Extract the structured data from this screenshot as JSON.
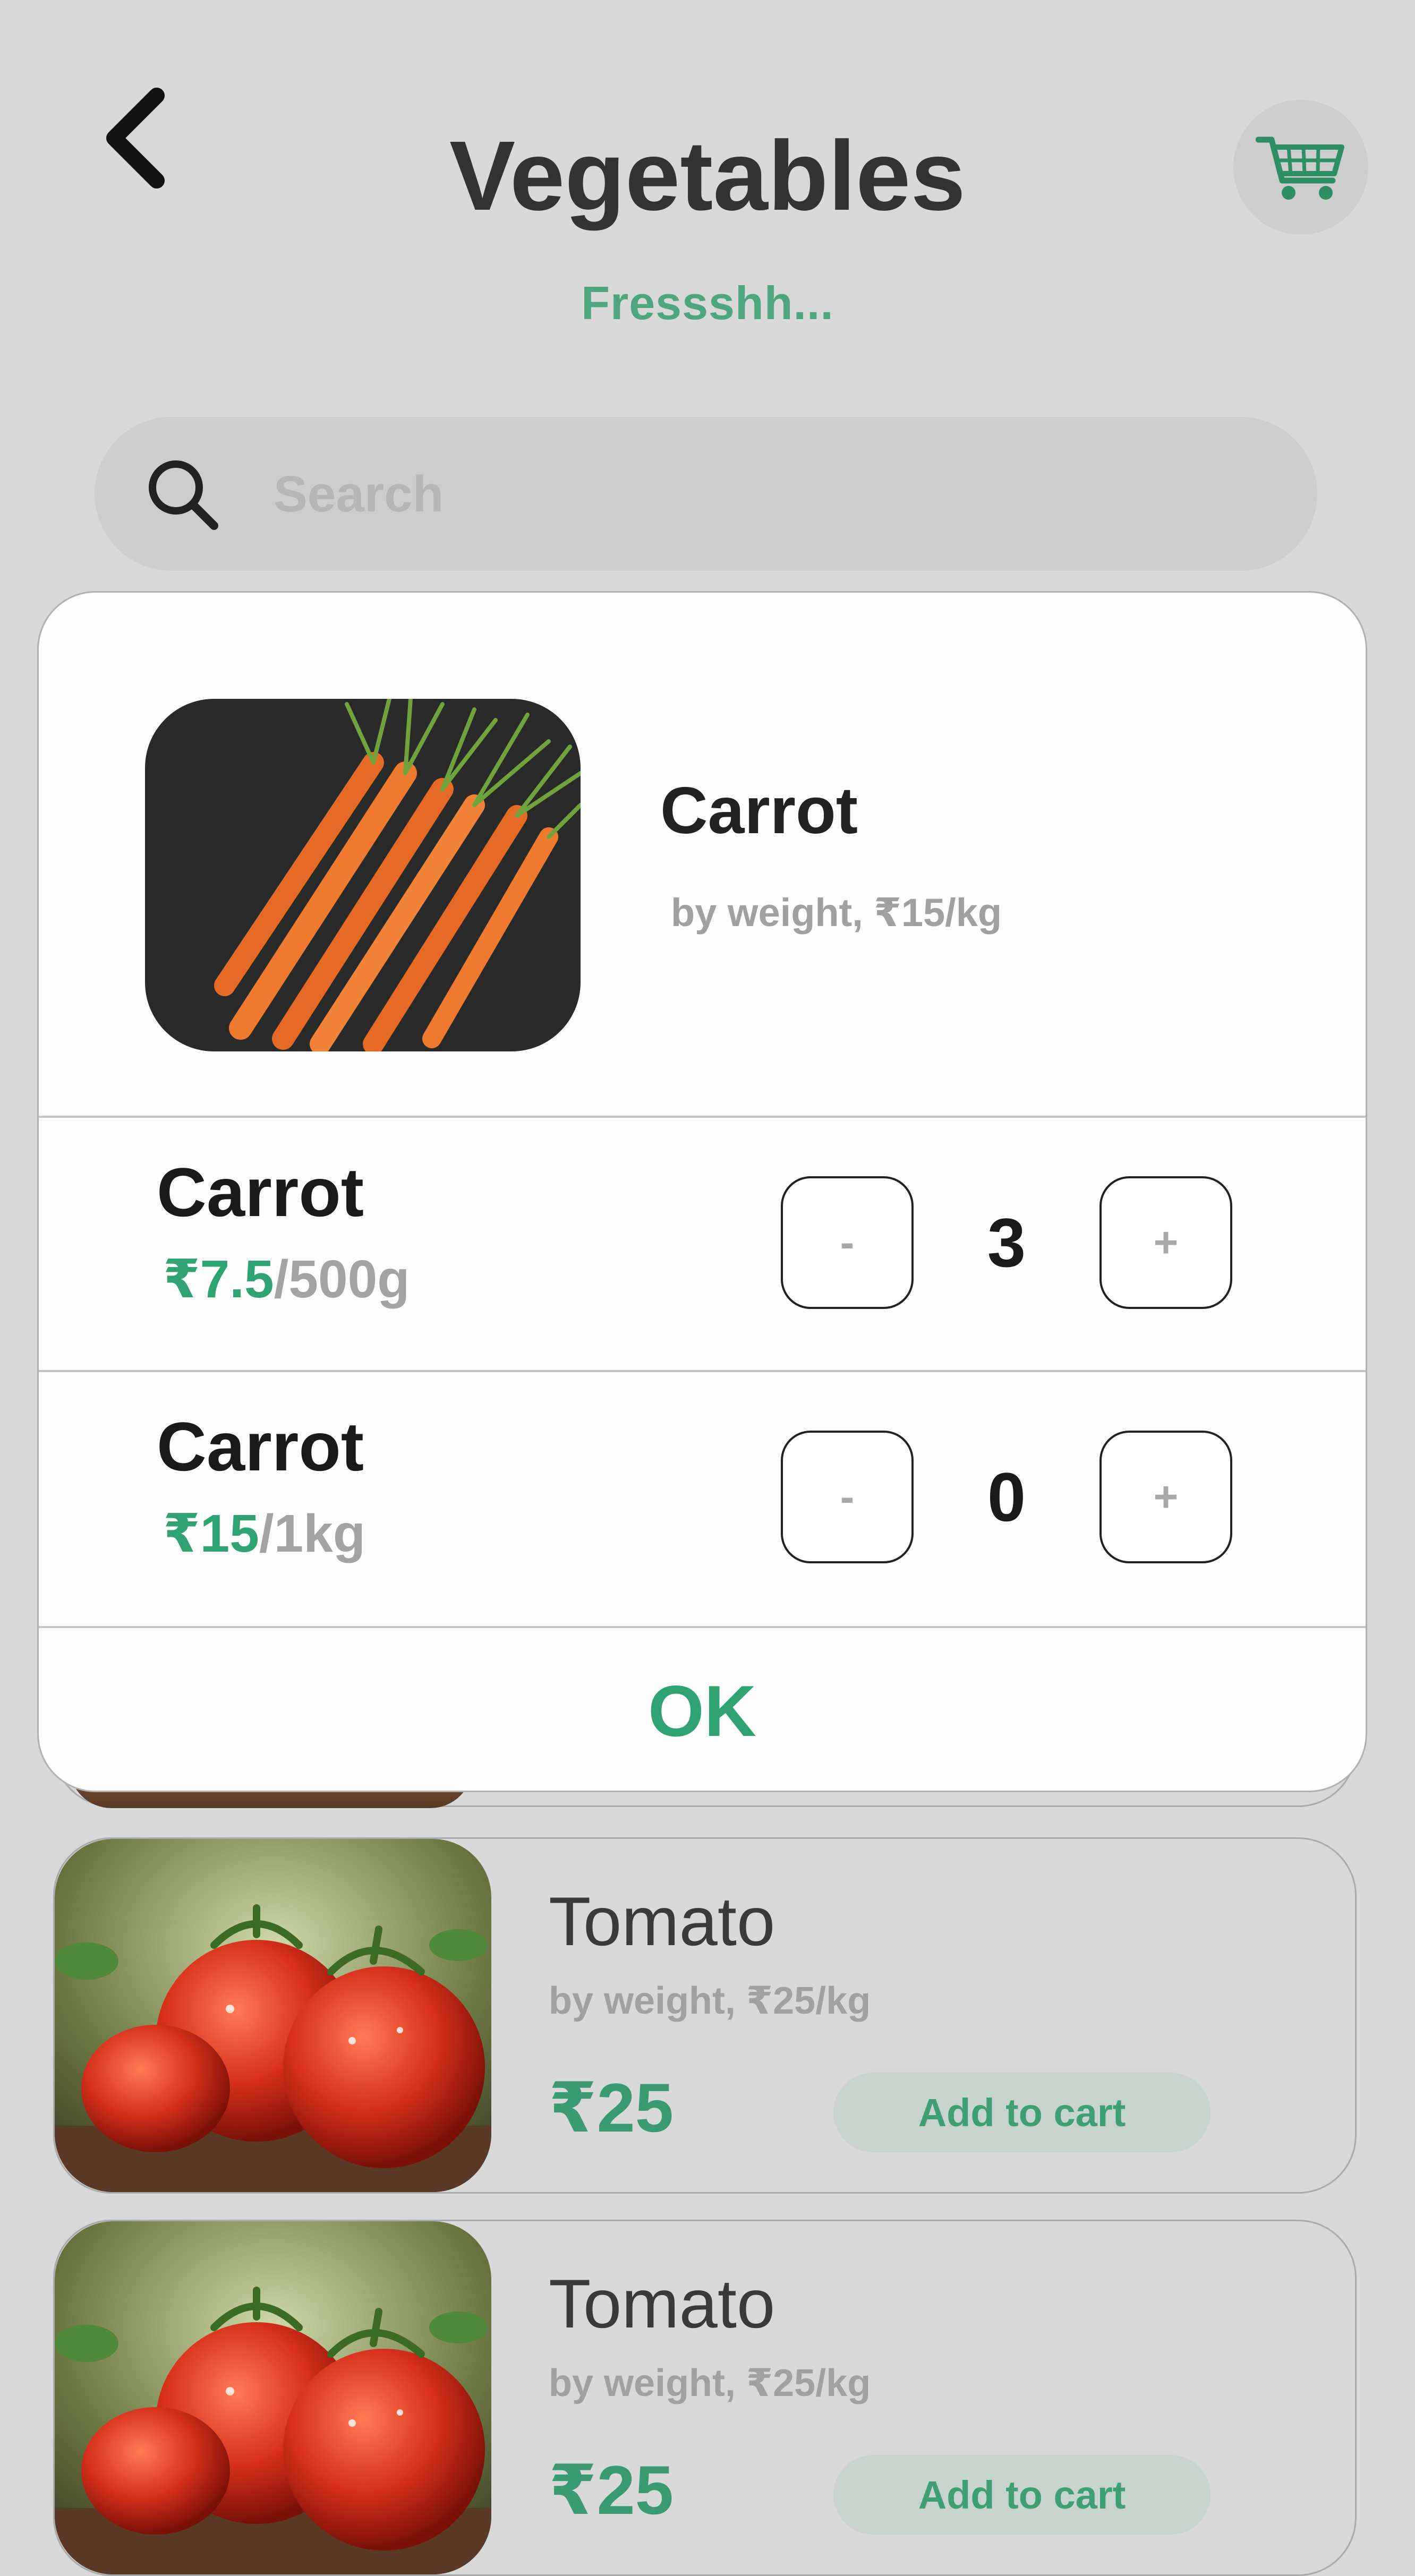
{
  "header": {
    "title": "Vegetables",
    "subtitle": "Fressshh..."
  },
  "search": {
    "placeholder": "Search",
    "value": ""
  },
  "products": [
    {
      "name": "Tomato",
      "description": "by weight, ₹25/kg",
      "price": "₹25",
      "add_label": "Add to cart"
    },
    {
      "name": "Tomato",
      "description": "by weight, ₹25/kg",
      "price": "₹25",
      "add_label": "Add to cart"
    }
  ],
  "modal": {
    "name": "Carrot",
    "description": "by weight, ₹15/kg",
    "variants": [
      {
        "name": "Carrot",
        "price": "₹7.5",
        "unit": "/500g",
        "quantity": "3",
        "minus_label": "-",
        "plus_label": "+"
      },
      {
        "name": "Carrot",
        "price": "₹15",
        "unit": "/1kg",
        "quantity": "0",
        "minus_label": "-",
        "plus_label": "+"
      }
    ],
    "ok_label": "OK"
  },
  "icons": {
    "back": "chevron-left-icon",
    "cart": "shopping-cart-icon",
    "search": "search-icon"
  },
  "colors": {
    "accent": "#2fa371",
    "subtitle": "#4ea67e",
    "background": "#d8d8d8",
    "modal_bg": "#fdfdfd"
  }
}
